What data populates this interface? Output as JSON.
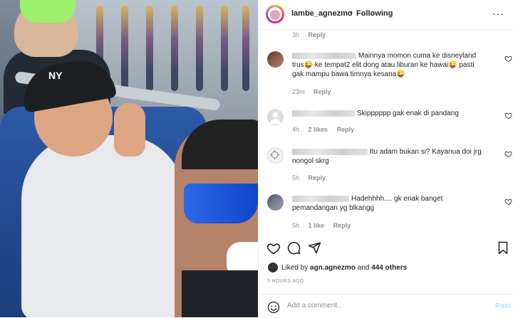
{
  "header": {
    "username": "lambe_agnezmo",
    "separator": "•",
    "follow_label": "Following",
    "more_label": "···"
  },
  "top_meta": {
    "time": "3h",
    "reply": "Reply"
  },
  "comments": [
    {
      "text": "Mainnya momon cuma ke disneyland trus😜 ke tempat2 elit dong atau liburan ke hawai😜 pasti gak mampu bawa timnya kesana😜",
      "time": "23m",
      "likes": "",
      "reply": "Reply"
    },
    {
      "text": "Skipppppp gak enak di pandang",
      "time": "4h",
      "likes": "2 likes",
      "reply": "Reply"
    },
    {
      "text": "Itu adam bukan si? Kayanua doi jrg nongol skrg",
      "time": "5h",
      "likes": "",
      "reply": "Reply"
    },
    {
      "text": "Hadehhhh.... gk enak banget pemandangan yg blkangg",
      "time": "5h",
      "likes": "1 like",
      "reply": "Reply"
    }
  ],
  "liked_by": {
    "prefix": "Liked by",
    "user": "agn.agnezmo",
    "conj": "and",
    "others": "444 others"
  },
  "time_ago": "5 HOURS AGO",
  "add_comment": {
    "placeholder": "Add a comment...",
    "post_label": "Post"
  },
  "icons": {
    "heart": "heart-icon",
    "comment": "comment-icon",
    "share": "share-icon",
    "bookmark": "bookmark-icon",
    "emoji": "emoji-icon"
  },
  "colors": {
    "post_disabled": "#b2dffc",
    "meta_gray": "#8e8e8e",
    "text": "#262626"
  }
}
